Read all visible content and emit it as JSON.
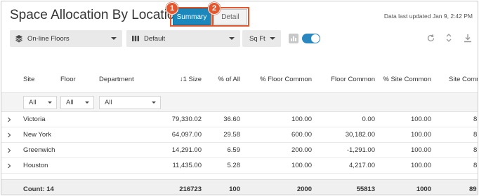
{
  "header": {
    "title": "Space Allocation By Location",
    "tabs": [
      {
        "label": "Summary",
        "callout": "1"
      },
      {
        "label": "Detail",
        "callout": "2"
      }
    ],
    "updated": "Data last updated Jan 9, 2:42 PM"
  },
  "toolbar": {
    "floors_select": "On-line Floors",
    "view_select": "Default",
    "units_select": "Sq Ft",
    "chart_toggle_on": true,
    "icons": [
      "layers-icon",
      "columns-icon",
      "bar-chart-icon",
      "refresh-icon",
      "expand-collapse-icon",
      "download-icon"
    ]
  },
  "table": {
    "columns": [
      "Site",
      "Floor",
      "Department",
      "↓1 Size",
      "% of All",
      "% Floor Common",
      "Floor Common",
      "% Site Common",
      "Site Comm"
    ],
    "filters": [
      "All",
      "All",
      "All"
    ],
    "rows": [
      [
        "Victoria",
        "79,330.02",
        "36.60",
        "100.00",
        "0.00",
        "100.00",
        "8"
      ],
      [
        "New York",
        "64,097.00",
        "29.58",
        "600.00",
        "30,182.00",
        "100.00",
        "8"
      ],
      [
        "Greenwich",
        "14,291.00",
        "6.59",
        "200.00",
        "-1,291.00",
        "100.00",
        "8"
      ],
      [
        "Houston",
        "11,435.00",
        "5.28",
        "100.00",
        "4,217.00",
        "100.00",
        "8"
      ]
    ],
    "footer": [
      "Count: 14",
      "216723",
      "100",
      "2000",
      "55813",
      "1000",
      "89"
    ]
  },
  "colors": {
    "accent": "#1b88bd",
    "callout": "#e4572e",
    "toggle": "#2b87bf"
  }
}
